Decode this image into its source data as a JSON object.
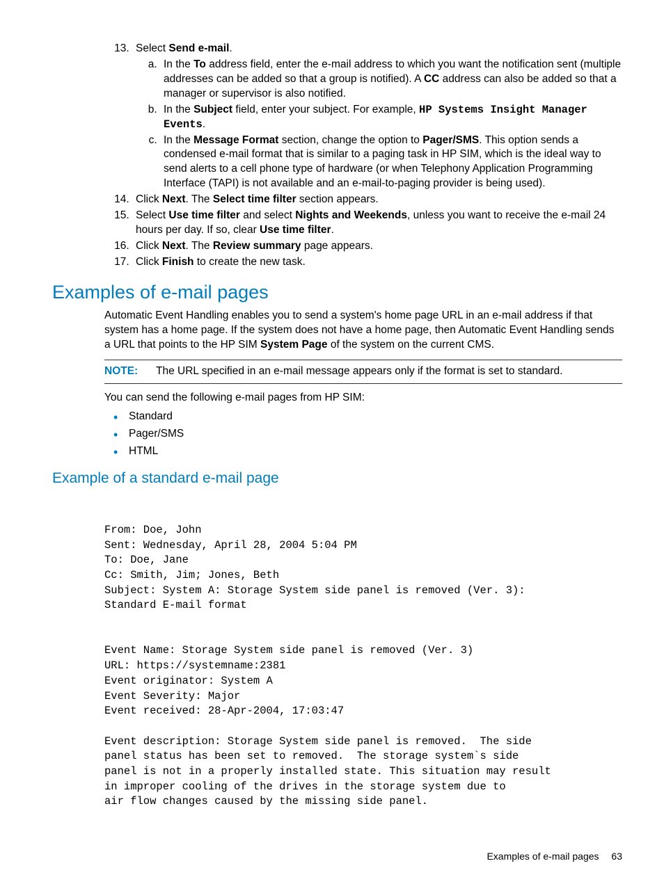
{
  "steps": {
    "s13": {
      "pre": "Select ",
      "bold1": "Send e-mail",
      "post1": ".",
      "a": {
        "t1": "In the ",
        "b1": "To",
        "t2": " address field, enter the e-mail address to which you want the notification sent (multiple addresses can be added so that a group is notified). A ",
        "b2": "CC",
        "t3": " address can also be added so that a manager or supervisor is also notified."
      },
      "b_item": {
        "t1": "In the ",
        "b1": "Subject",
        "t2": " field, enter your subject. For example, ",
        "m1": "HP Systems Insight Manager Events",
        "t3": "."
      },
      "c_item": {
        "t1": "In the ",
        "b1": "Message Format",
        "t2": " section, change the option to ",
        "b2": "Pager/SMS",
        "t3": ". This option sends a condensed e-mail format that is similar to a paging task in HP SIM, which is the ideal way to send alerts to a cell phone type of hardware (or when Telephony Application Programming Interface (TAPI) is not available and an e-mail-to-paging provider is being used)."
      }
    },
    "s14": {
      "t1": "Click ",
      "b1": "Next",
      "t2": ". The ",
      "b2": "Select time filter",
      "t3": " section appears."
    },
    "s15": {
      "t1": "Select ",
      "b1": "Use time filter",
      "t2": " and select ",
      "b2": "Nights and Weekends",
      "t3": ", unless you want to receive the e-mail 24 hours per day. If so, clear ",
      "b3": "Use time filter",
      "t4": "."
    },
    "s16": {
      "t1": "Click ",
      "b1": "Next",
      "t2": ". The ",
      "b2": "Review summary",
      "t3": " page appears."
    },
    "s17": {
      "t1": "Click ",
      "b1": "Finish",
      "t2": " to create the new task."
    }
  },
  "section1_title": "Examples of e-mail pages",
  "section1_para": {
    "t1": "Automatic Event Handling enables you to send a system's home page URL in an e-mail address if that system has a home page. If the system does not have a home page, then Automatic Event Handling sends a URL that points to the HP SIM ",
    "b1": "System Page",
    "t2": " of the system on the current CMS."
  },
  "note_label": "NOTE:",
  "note_text": "The URL specified in an e-mail message appears only if the format is set to standard.",
  "section1_para2": "You can send the following e-mail pages from HP SIM:",
  "bullets": [
    "Standard",
    "Pager/SMS",
    "HTML"
  ],
  "section2_title": "Example of a standard e-mail page",
  "email_example": "From: Doe, John\nSent: Wednesday, April 28, 2004 5:04 PM\nTo: Doe, Jane\nCc: Smith, Jim; Jones, Beth\nSubject: System A: Storage System side panel is removed (Ver. 3):\nStandard E-mail format\n\n\nEvent Name: Storage System side panel is removed (Ver. 3)\nURL: https://systemname:2381\nEvent originator: System A\nEvent Severity: Major\nEvent received: 28-Apr-2004, 17:03:47\n\nEvent description: Storage System side panel is removed.  The side\npanel status has been set to removed.  The storage system`s side\npanel is not in a properly installed state. This situation may result\nin improper cooling of the drives in the storage system due to\nair flow changes caused by the missing side panel.",
  "footer_text": "Examples of e-mail pages",
  "footer_page": "63"
}
